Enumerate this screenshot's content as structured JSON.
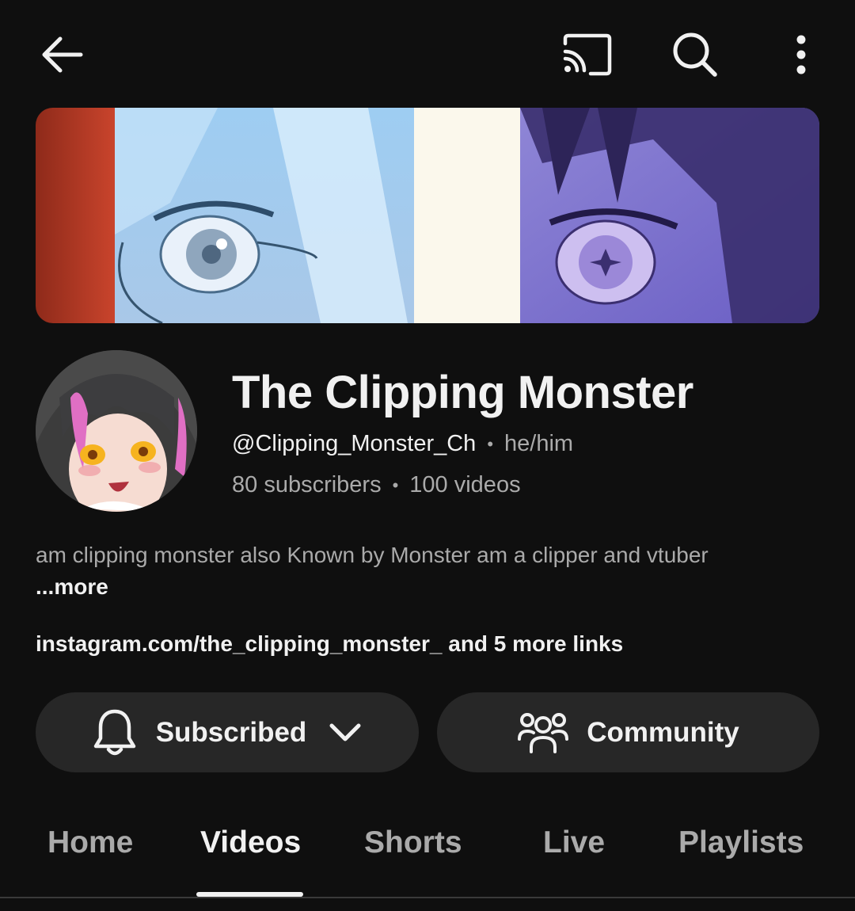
{
  "channel": {
    "name": "The Clipping Monster",
    "handle": "@Clipping_Monster_Ch",
    "pronouns": "he/him",
    "subscribers": "80 subscribers",
    "videos": "100 videos",
    "description": "am clipping monster also Known by Monster am a clipper and vtuber",
    "more_label": "...more",
    "links": "instagram.com/the_clipping_monster_ and 5 more links",
    "separator": "•"
  },
  "actions": {
    "subscribed_label": "Subscribed",
    "community_label": "Community"
  },
  "tabs": [
    {
      "label": "Home",
      "active": false
    },
    {
      "label": "Videos",
      "active": true
    },
    {
      "label": "Shorts",
      "active": false
    },
    {
      "label": "Live",
      "active": false
    },
    {
      "label": "Playlists",
      "active": false
    }
  ],
  "icons": {
    "back": "arrow-left-icon",
    "cast": "cast-icon",
    "search": "search-icon",
    "more": "more-vert-icon",
    "bell": "bell-icon",
    "chevron": "chevron-down-icon",
    "community": "people-icon"
  },
  "colors": {
    "background": "#0f0f0f",
    "button_bg": "#272727",
    "text_primary": "#f1f1f1",
    "text_secondary": "#aaaaaa"
  }
}
